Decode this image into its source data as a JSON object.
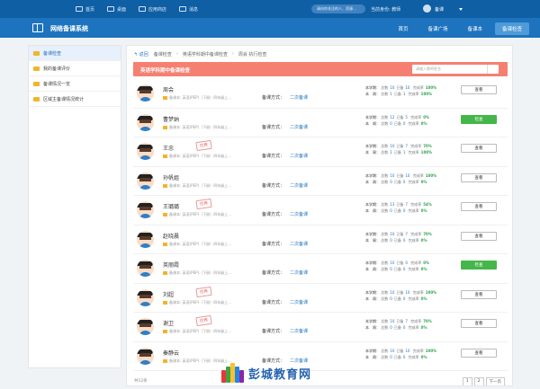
{
  "topbar": {
    "items": [
      {
        "label": "首页",
        "icon": "home-icon"
      },
      {
        "label": "桌面",
        "icon": "desktop-icon"
      },
      {
        "label": "应用商店",
        "icon": "store-icon"
      },
      {
        "label": "消息",
        "icon": "message-icon"
      }
    ],
    "search_placeholder": "请向你关注的人、资源…",
    "current_identity": "当前身份: 教师",
    "user_name": "备课"
  },
  "header": {
    "app_title": "网络备课系统",
    "nav": [
      "首页",
      "备课广场",
      "备课本",
      "备课检查"
    ],
    "nav_active": "备课检查"
  },
  "sidebar": {
    "items": [
      "备课检查",
      "我的备课评价",
      "备课情况一览",
      "区域主备课情况统计"
    ],
    "active": "备课检查"
  },
  "breadcrumb": {
    "back": "返回",
    "items": [
      "备课检查",
      "英语学科期中备课检查",
      "周会 执行检查"
    ]
  },
  "banner": {
    "title": "英语学科期中备课检查",
    "search_placeholder": "请输入教师姓名"
  },
  "row_labels": {
    "sub_prefix": "备课本:",
    "sub_text": "英语(PEP)（下册）四年级上…",
    "method_label": "备课方式：",
    "method_value": "二次备课",
    "semester_label": "本学期：",
    "week_label": "本　周：",
    "total_label": "总数",
    "done_label": "已备",
    "rate_label": "完成率"
  },
  "teachers": [
    {
      "name": "周会",
      "stamp": "",
      "semester": {
        "total": "10",
        "done": "10",
        "rate": "100%"
      },
      "week": {
        "total": "1",
        "done": "1",
        "rate": "100%"
      },
      "button": "查看",
      "button_style": "default"
    },
    {
      "name": "曹梦纳",
      "stamp": "",
      "semester": {
        "total": "12",
        "done": "5",
        "rate": "0%"
      },
      "week": {
        "total": "0",
        "done": "0",
        "rate": "0%"
      },
      "button": "检查",
      "button_style": "green"
    },
    {
      "name": "王忠",
      "stamp": "优秀",
      "semester": {
        "total": "10",
        "done": "7",
        "rate": "70%"
      },
      "week": {
        "total": "1",
        "done": "1",
        "rate": "100%"
      },
      "button": "查看",
      "button_style": "default"
    },
    {
      "name": "孙帆姐",
      "stamp": "",
      "semester": {
        "total": "10",
        "done": "10",
        "rate": "100%"
      },
      "week": {
        "total": "0",
        "done": "0",
        "rate": "0%"
      },
      "button": "查看",
      "button_style": "default"
    },
    {
      "name": "王璐璐",
      "stamp": "优秀",
      "semester": {
        "total": "13",
        "done": "7",
        "rate": "54%"
      },
      "week": {
        "total": "0",
        "done": "0",
        "rate": "0%"
      },
      "button": "查看",
      "button_style": "default"
    },
    {
      "name": "赵晓晨",
      "stamp": "",
      "semester": {
        "total": "10",
        "done": "7",
        "rate": "70%"
      },
      "week": {
        "total": "0",
        "done": "0",
        "rate": "0%"
      },
      "button": "查看",
      "button_style": "default"
    },
    {
      "name": "英丽霞",
      "stamp": "",
      "semester": {
        "total": "10",
        "done": "0",
        "rate": "0%"
      },
      "week": {
        "total": "0",
        "done": "0",
        "rate": "0%"
      },
      "button": "检查",
      "button_style": "green"
    },
    {
      "name": "刘超",
      "stamp": "优秀",
      "semester": {
        "total": "10",
        "done": "10",
        "rate": "100%"
      },
      "week": {
        "total": "0",
        "done": "0",
        "rate": "0%"
      },
      "button": "查看",
      "button_style": "default"
    },
    {
      "name": "谢卫",
      "stamp": "优秀",
      "semester": {
        "total": "10",
        "done": "7",
        "rate": "70%"
      },
      "week": {
        "total": "0",
        "done": "0",
        "rate": "0%"
      },
      "button": "查看",
      "button_style": "default"
    },
    {
      "name": "秦静云",
      "stamp": "",
      "semester": {
        "total": "10",
        "done": "10",
        "rate": "100%"
      },
      "week": {
        "total": "0",
        "done": "0",
        "rate": "0%"
      },
      "button": "查看",
      "button_style": "default"
    }
  ],
  "footer": {
    "count": "共12条",
    "pages": [
      "1",
      "2",
      "下一页"
    ]
  },
  "watermark": {
    "text": "彭城教育网"
  },
  "colors": {
    "topbar": "#0f5fa5",
    "header": "#1e73be",
    "banner": "#f58072",
    "green_button": "#45b649",
    "rate_green": "#2ea04c"
  }
}
